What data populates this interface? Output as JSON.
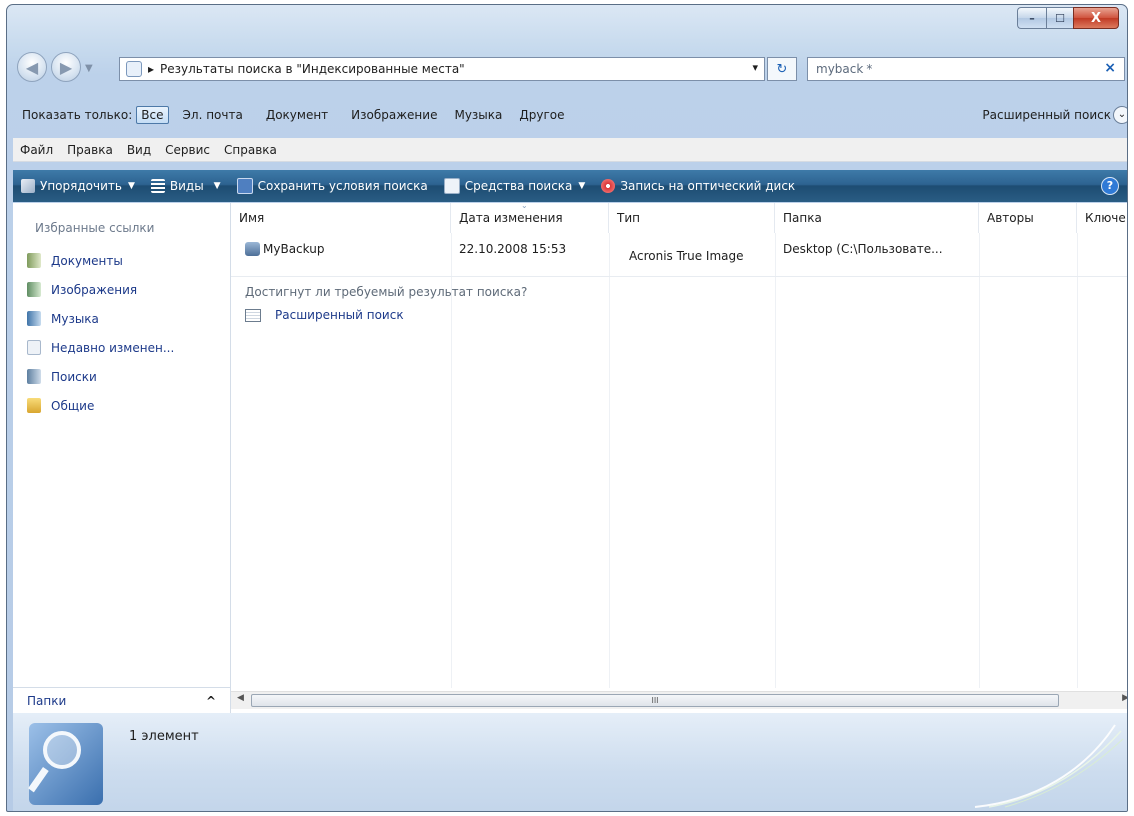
{
  "window": {
    "min_glyph": "–",
    "max_glyph": "☐",
    "close_glyph": "X"
  },
  "address": {
    "arrow": "▸",
    "path": "Результаты поиска в \"Индексированные места\"",
    "dropdown_glyph": "▾",
    "refresh_glyph": "↻"
  },
  "search": {
    "value": "myback",
    "clear_glyph": "×",
    "star": "*"
  },
  "filter": {
    "label": "Показать только:",
    "items": [
      "Все",
      "Эл. почта",
      "Документ",
      "Изображение",
      "Музыка",
      "Другое"
    ],
    "active_index": 0,
    "advanced": "Расширенный поиск"
  },
  "menu": [
    "Файл",
    "Правка",
    "Вид",
    "Сервис",
    "Справка"
  ],
  "commands": {
    "organize": "Упорядочить",
    "views": "Виды",
    "save_search": "Сохранить условия поиска",
    "search_tools": "Средства поиска",
    "burn": "Запись на оптический диск",
    "help_glyph": "?"
  },
  "nav": {
    "title": "Избранные ссылки",
    "items": [
      "Документы",
      "Изображения",
      "Музыка",
      "Недавно изменен...",
      "Поиски",
      "Общие"
    ],
    "folders": "Папки",
    "folders_chevron": "^"
  },
  "list": {
    "columns": [
      "Имя",
      "Дата изменения",
      "Тип",
      "Папка",
      "Авторы",
      "Ключе"
    ],
    "rows": [
      {
        "name": "MyBackup",
        "date": "22.10.2008 15:53",
        "type": "Acronis True Image",
        "folder": "Desktop (C:\\Пользовате..."
      }
    ],
    "question": "Достигнут ли требуемый результат поиска?",
    "advanced_link": "Расширенный поиск",
    "scroll_thumb": "III"
  },
  "details": {
    "count": "1 элемент"
  },
  "colors": {
    "accent": "#1d3a8a",
    "command_bar": "#2d6391"
  }
}
